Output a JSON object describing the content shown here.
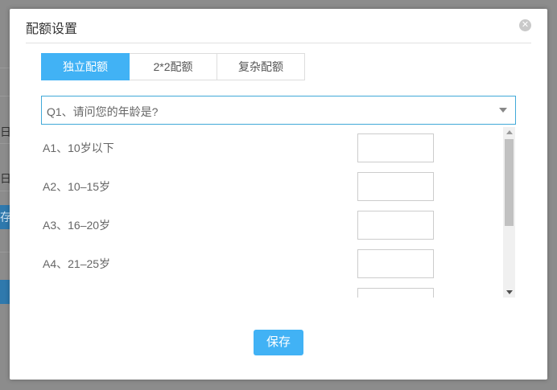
{
  "background": {
    "text_1": "日",
    "text_2": "日",
    "text_3": "存"
  },
  "modal": {
    "title": "配额设置",
    "close_icon": "close-icon"
  },
  "tabs": [
    {
      "label": "独立配额",
      "active": true
    },
    {
      "label": "2*2配额",
      "active": false
    },
    {
      "label": "复杂配额",
      "active": false
    }
  ],
  "question_select": {
    "value": "Q1、请问您的年龄是?"
  },
  "answers": [
    {
      "label": "A1、10岁以下",
      "value": ""
    },
    {
      "label": "A2、10–15岁",
      "value": ""
    },
    {
      "label": "A3、16–20岁",
      "value": ""
    },
    {
      "label": "A4、21–25岁",
      "value": ""
    },
    {
      "label": "",
      "value": ""
    }
  ],
  "footer": {
    "save_label": "保存"
  },
  "colors": {
    "accent": "#41b2f5",
    "select_border": "#41a9d8"
  }
}
